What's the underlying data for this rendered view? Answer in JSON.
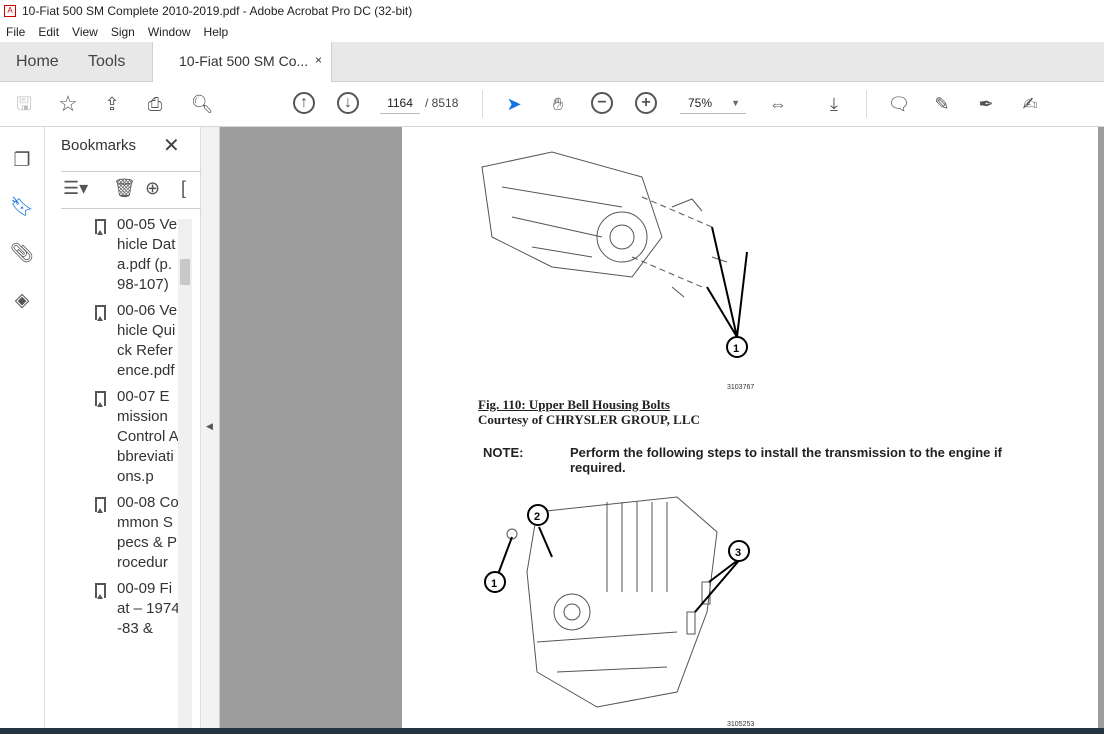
{
  "window": {
    "title": "10-Fiat 500 SM Complete 2010-2019.pdf - Adobe Acrobat Pro DC (32-bit)"
  },
  "menu": [
    "File",
    "Edit",
    "View",
    "Sign",
    "Window",
    "Help"
  ],
  "tabs": {
    "home": "Home",
    "tools": "Tools",
    "document": "10-Fiat 500 SM Co...",
    "close": "×"
  },
  "toolbar": {
    "page_current": "1164",
    "page_total": "/ 8518",
    "zoom": "75%",
    "accent": "#1473e6"
  },
  "bookmarks": {
    "title": "Bookmarks",
    "close": "✕",
    "items": [
      {
        "label": "00-05 Vehicle Data.pdf (p.98-107)"
      },
      {
        "label": "00-06 Vehicle Quick Reference.pdf"
      },
      {
        "label": "00-07 Emission Control Abbreviations.p"
      },
      {
        "label": "00-08 Common Specs & Procedur"
      },
      {
        "label": "00-09 Fiat – 1974-83 &"
      }
    ]
  },
  "document": {
    "fig1_id": "3103767",
    "fig1_caption": "Fig. 110: Upper Bell Housing Bolts",
    "fig1_credit": "Courtesy of CHRYSLER GROUP, LLC",
    "note_label": "NOTE:",
    "note_text": "Perform the following steps to install the transmission to the engine if required.",
    "fig2_id": "3105253",
    "callouts": [
      "1",
      "2",
      "3"
    ]
  }
}
